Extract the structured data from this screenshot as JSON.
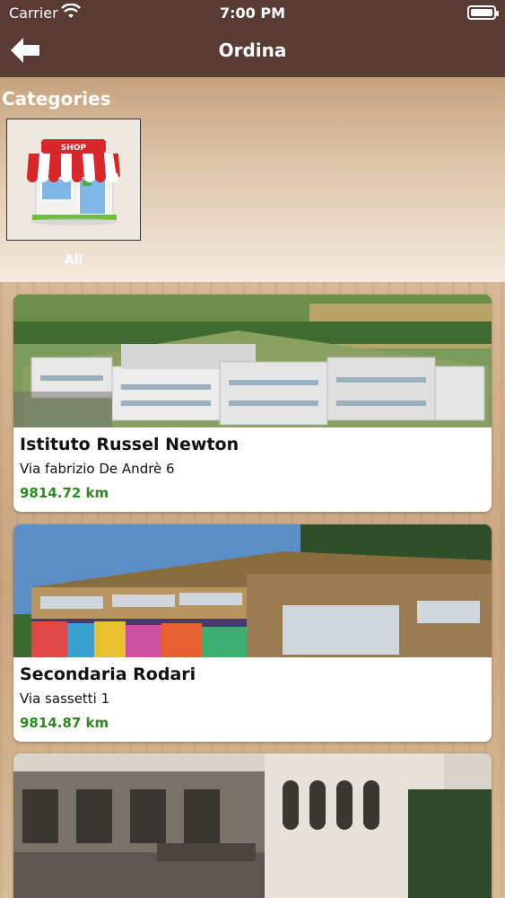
{
  "status_bar": {
    "carrier": "Carrier",
    "time": "7:00 PM"
  },
  "nav": {
    "title": "Ordina",
    "back_icon": "arrow-left-icon"
  },
  "categories": {
    "title": "Categories",
    "items": [
      {
        "label": "All",
        "icon": "shop-icon",
        "sign": "SHOP"
      }
    ]
  },
  "places": [
    {
      "name": "Istituto Russel Newton",
      "address": "Via fabrizio De Andrè 6",
      "distance": "9814.72 km"
    },
    {
      "name": "Secondaria Rodari",
      "address": "Via sassetti 1",
      "distance": "9814.87 km"
    },
    {
      "name": "",
      "address": "",
      "distance": ""
    }
  ]
}
